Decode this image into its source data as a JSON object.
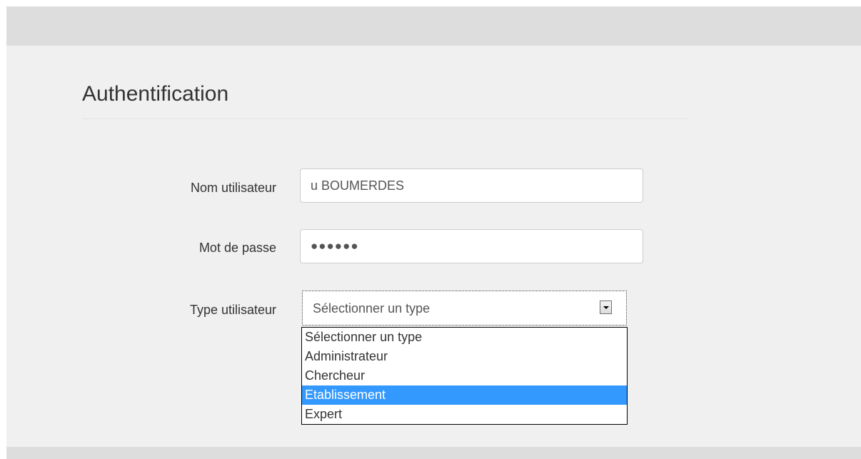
{
  "form": {
    "title": "Authentification",
    "username": {
      "label": "Nom utilisateur",
      "value": "u BOUMERDES"
    },
    "password": {
      "label": "Mot de passe",
      "value": "●●●●●●"
    },
    "user_type": {
      "label": "Type utilisateur",
      "selected_display": "Sélectionner un type",
      "highlighted_option": "Etablissement",
      "options": [
        "Sélectionner un type",
        "Administrateur",
        "Chercheur",
        "Etablissement",
        "Expert"
      ],
      "arrow_icon": "dropdown-arrow-icon"
    }
  },
  "colors": {
    "header_bar": "#dddddd",
    "panel_background": "#f0f0f0",
    "highlight": "#3399ff",
    "text": "#333333"
  }
}
